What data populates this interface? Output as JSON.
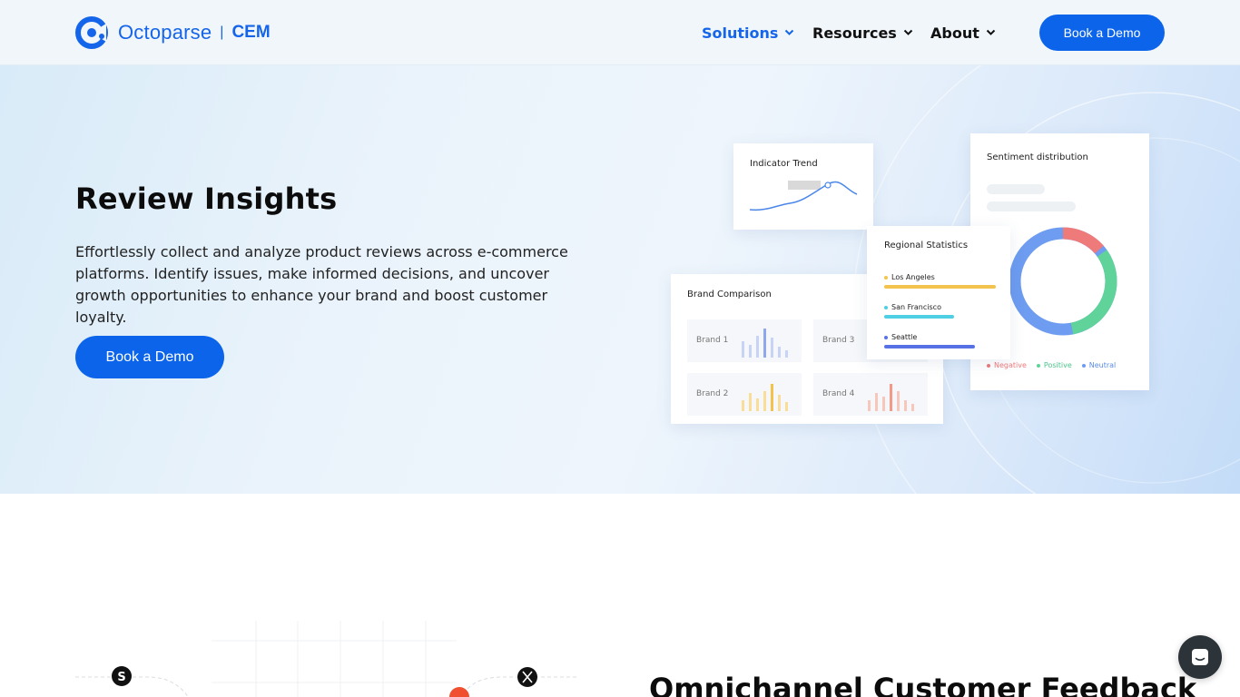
{
  "header": {
    "logo": {
      "brand": "Octoparse",
      "separator": "|",
      "product": "CEM"
    },
    "nav": [
      {
        "label": "Solutions",
        "active": true
      },
      {
        "label": "Resources",
        "active": false
      },
      {
        "label": "About",
        "active": false
      }
    ],
    "cta_label": "Book a Demo"
  },
  "hero": {
    "title": "Review Insights",
    "description": "Effortlessly collect and analyze product reviews across e-commerce platforms. Identify issues, make informed decisions, and uncover growth opportunities to enhance your brand and boost customer loyalty.",
    "cta_label": "Book a Demo",
    "dashboard": {
      "indicator_trend": {
        "title": "Indicator Trend"
      },
      "sentiment_distribution": {
        "title": "Sentiment distribution",
        "legend": [
          {
            "label": "Negative",
            "color": "#ef7a7a"
          },
          {
            "label": "Positive",
            "color": "#5fd39a"
          },
          {
            "label": "Neutral",
            "color": "#6d9cf0"
          }
        ]
      },
      "regional_statistics": {
        "title": "Regional Statistics",
        "rows": [
          {
            "city": "Los Angeles",
            "color": "#f2c34d",
            "level": 0.96
          },
          {
            "city": "San Francisco",
            "color": "#4fcfe4",
            "level": 0.6
          },
          {
            "city": "Seattle",
            "color": "#5872e6",
            "level": 0.78
          }
        ]
      },
      "brand_comparison": {
        "title": "Brand Comparison",
        "brands": [
          {
            "label": "Brand 1",
            "color": "#8fa8ec"
          },
          {
            "label": "Brand 3",
            "color": "#7fd7b0"
          },
          {
            "label": "Brand 2",
            "color": "#f4c24a"
          },
          {
            "label": "Brand 4",
            "color": "#f29a86"
          }
        ]
      }
    }
  },
  "section2": {
    "title": "Omnichannel Customer Feedback"
  },
  "chat": {
    "icon": "chat-icon"
  },
  "colors": {
    "primary": "#0b64ea",
    "brand": "#1565ea"
  }
}
